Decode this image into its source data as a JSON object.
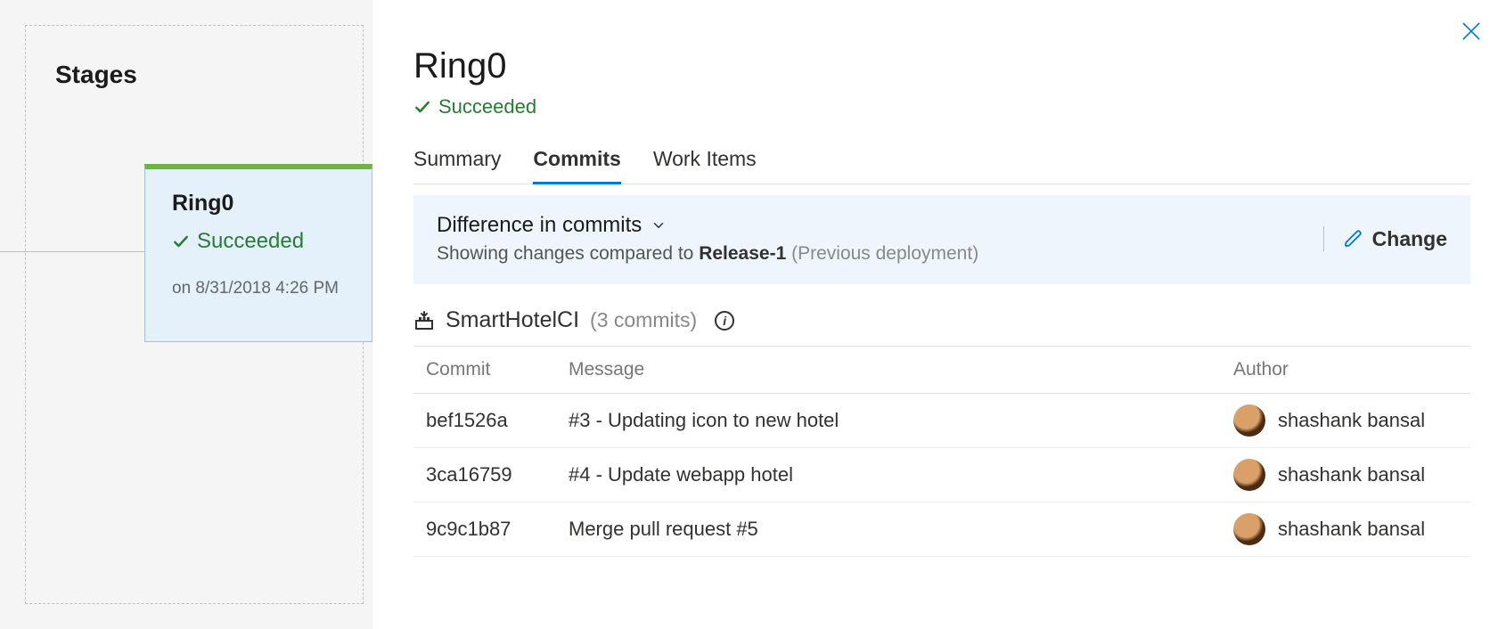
{
  "left": {
    "title": "Stages",
    "card": {
      "name": "Ring0",
      "status": "Succeeded",
      "date": "on 8/31/2018 4:26 PM"
    }
  },
  "detail": {
    "title": "Ring0",
    "status": "Succeeded",
    "tabs": [
      "Summary",
      "Commits",
      "Work Items"
    ],
    "active_tab": 1,
    "diff": {
      "title": "Difference in commits",
      "sub_prefix": "Showing changes compared to ",
      "sub_strong": "Release-1",
      "sub_suffix": " (Previous deployment)",
      "change_label": "Change"
    },
    "source": {
      "name": "SmartHotelCI",
      "count_label": "(3 commits)"
    },
    "columns": {
      "commit": "Commit",
      "message": "Message",
      "author": "Author"
    },
    "rows": [
      {
        "hash": "bef1526a",
        "message": "#3 - Updating icon to new hotel",
        "author": "shashank bansal"
      },
      {
        "hash": "3ca16759",
        "message": "#4 - Update webapp hotel",
        "author": "shashank bansal"
      },
      {
        "hash": "9c9c1b87",
        "message": "Merge pull request #5",
        "author": "shashank bansal"
      }
    ]
  }
}
